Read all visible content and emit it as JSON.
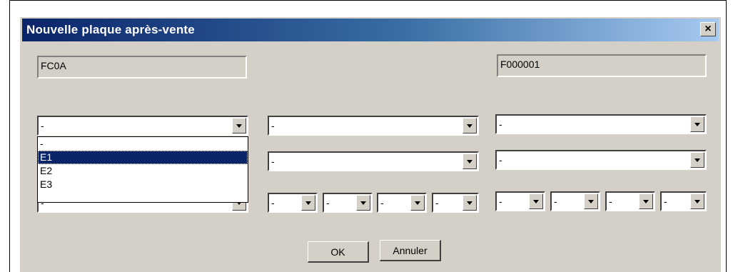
{
  "window": {
    "title": "Nouvelle plaque après-vente",
    "close_label": "×"
  },
  "fields": {
    "left_code": "FC0A",
    "right_code": "F000001"
  },
  "combos": {
    "col1_row1": "-",
    "col1_row3": "-",
    "col2_row1": "-",
    "col2_row2": "-",
    "col3_row1": "-",
    "col3_row2": "-",
    "small_mid": [
      "-",
      "-",
      "-",
      "-"
    ],
    "small_right": [
      "-",
      "-",
      "-",
      "-"
    ]
  },
  "dropdown": {
    "options": [
      "-",
      "E1",
      "E2",
      "E3"
    ],
    "selected": "E1"
  },
  "buttons": {
    "ok": "OK",
    "cancel": "Annuler"
  }
}
